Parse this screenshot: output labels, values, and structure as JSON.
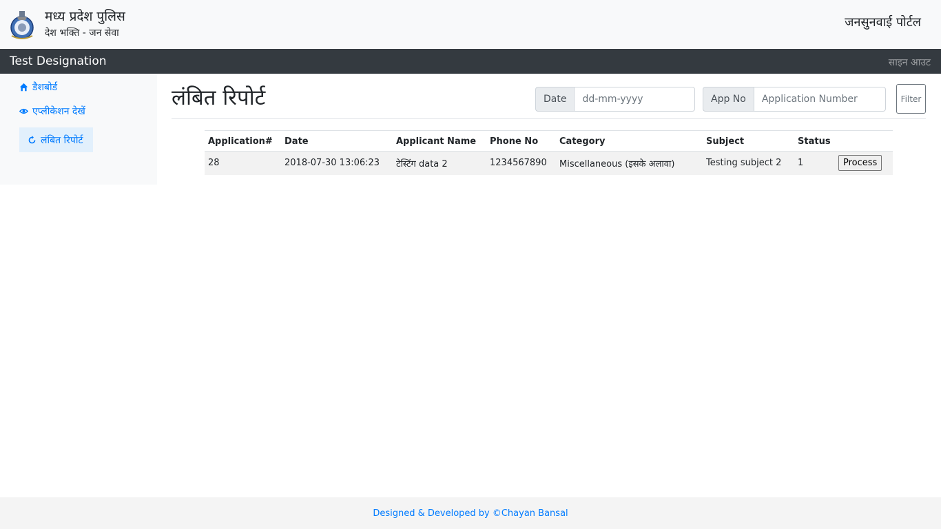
{
  "header": {
    "brand_title": "मध्य प्रदेश पुलिस",
    "brand_subtitle": "देश भक्ति - जन सेवा",
    "portal_name": "जनसुनवाई पोर्टल",
    "logo_icon": "mp-police-emblem-icon"
  },
  "navbar": {
    "designation": "Test Designation",
    "signout_label": "साइन आउट"
  },
  "sidebar": {
    "items": [
      {
        "label": "डैशबोर्ड",
        "icon": "home-icon"
      },
      {
        "label": "एप्लीकेशन देखें",
        "icon": "eye-icon"
      },
      {
        "label": "लंबित रिपोर्ट",
        "icon": "refresh-icon",
        "active": true
      }
    ]
  },
  "main": {
    "title": "लंबित रिपोर्ट",
    "filters": {
      "date_label": "Date",
      "date_placeholder": "dd-mm-yyyy",
      "appno_label": "App No",
      "appno_placeholder": "Application Number",
      "filter_label": "Filter"
    },
    "table": {
      "columns": [
        "Application#",
        "Date",
        "Applicant Name",
        "Phone No",
        "Category",
        "Subject",
        "Status",
        ""
      ],
      "rows": [
        {
          "application": "28",
          "date": "2018-07-30 13:06:23",
          "applicant_name": "टेस्टिंग data 2",
          "phone": "1234567890",
          "category": "Miscellaneous (इसके अलावा)",
          "subject": "Testing subject 2",
          "status": "1",
          "action_label": "Process"
        }
      ]
    }
  },
  "footer": {
    "text": "Designed & Developed by ©Chayan Bansal"
  },
  "colors": {
    "navbar_bg": "#343a40",
    "link": "#007bff",
    "header_bg": "#f8f9fa"
  }
}
